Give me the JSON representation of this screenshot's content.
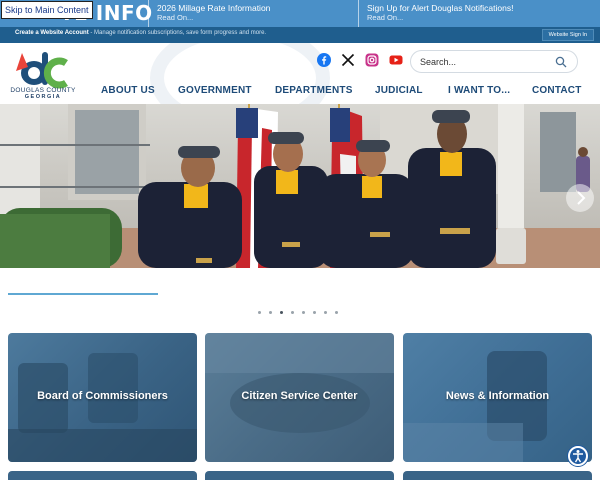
{
  "skip_link": "Skip to Main Content",
  "alert_bar": {
    "big_label": "TE INFO",
    "items": [
      {
        "title": "2026 Millage Rate Information",
        "read_on": "Read On..."
      },
      {
        "title": "Sign Up for Alert Douglas Notifications!",
        "read_on": "Read On..."
      }
    ]
  },
  "account_bar": {
    "create_label": "Create a Website Account",
    "description": " - Manage notification subscriptions, save form progress and more.",
    "sign_in": "Website Sign In"
  },
  "logo": {
    "monogram": "dc",
    "line1": "DOUGLAS COUNTY",
    "line2": "GEORGIA"
  },
  "social_icons": [
    "facebook-icon",
    "x-icon",
    "instagram-icon",
    "youtube-icon"
  ],
  "search": {
    "placeholder": "Search..."
  },
  "nav": [
    "ABOUT US",
    "GOVERNMENT",
    "DEPARTMENTS",
    "JUDICIAL",
    "I WANT TO...",
    "CONTACT"
  ],
  "slider": {
    "slide_count": 8,
    "active_index": 2
  },
  "cards": [
    {
      "label": "Board of Commissioners"
    },
    {
      "label": "Citizen Service Center"
    },
    {
      "label": "News & Information"
    }
  ],
  "colors": {
    "alert_bar": "#4a90c8",
    "account_bar": "#1f5e8e",
    "nav_text": "#1e4b78",
    "divider": "#5fa8d3"
  }
}
